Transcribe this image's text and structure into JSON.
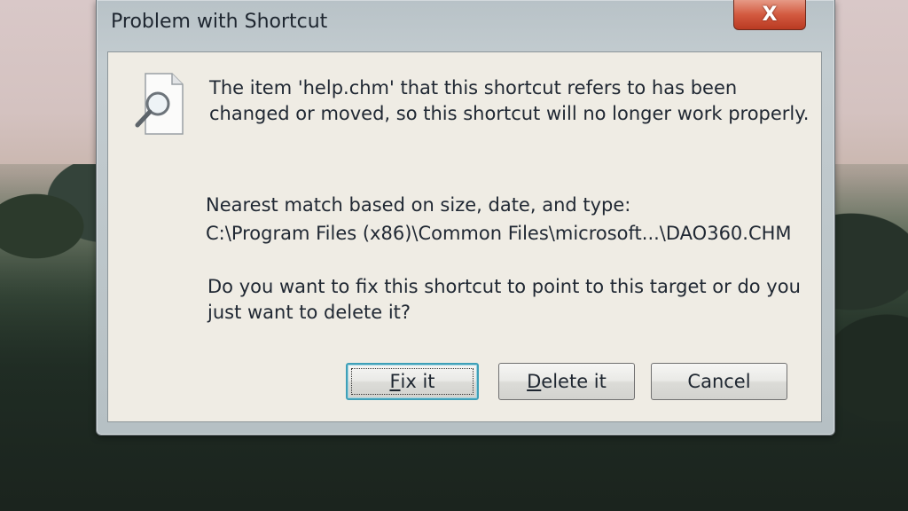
{
  "dialog": {
    "title": "Problem with Shortcut",
    "close_glyph": "X",
    "icon": "document-magnifier-icon",
    "message": "The item 'help.chm' that this shortcut refers to has been changed or moved, so this shortcut will no longer work properly.",
    "nearest_label": "Nearest match based on size, date, and type:",
    "nearest_path": "C:\\Program Files (x86)\\Common Files\\microsoft...\\DAO360.CHM",
    "question": "Do you want to fix this shortcut to point to this target or do you just want to delete it?"
  },
  "buttons": {
    "fix": {
      "accel": "F",
      "rest": "ix it"
    },
    "delete": {
      "accel": "D",
      "rest": "elete it"
    },
    "cancel": {
      "label": "Cancel"
    }
  },
  "colors": {
    "close_button": "#d35a40",
    "focus_ring": "#3fa0b8",
    "content_background": "#efece4"
  }
}
